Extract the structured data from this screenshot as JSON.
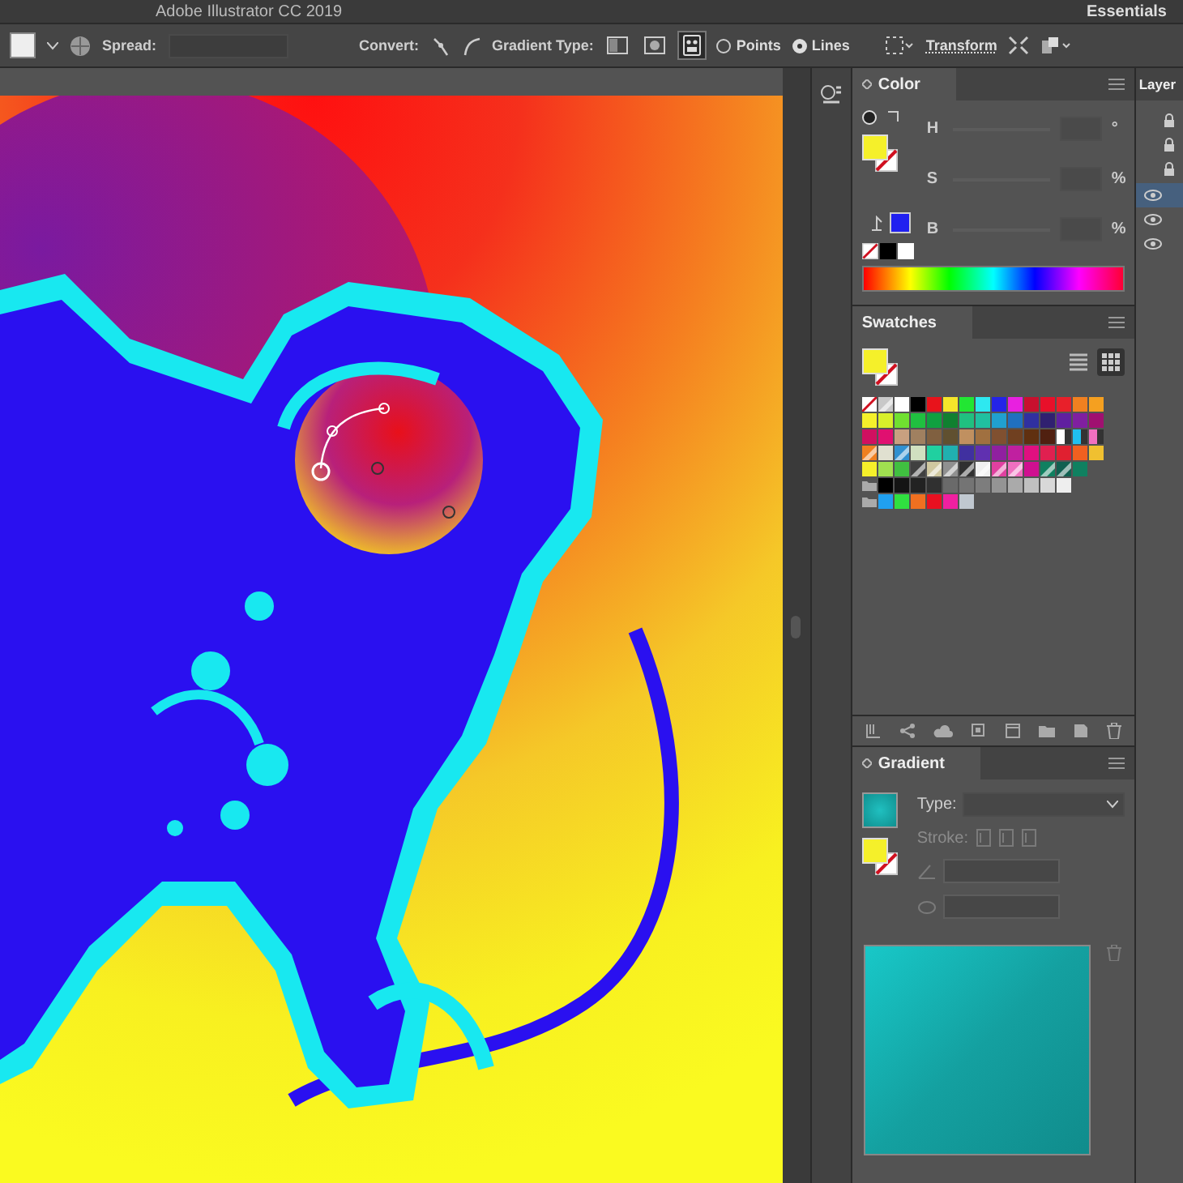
{
  "window": {
    "title": "Adobe Illustrator CC 2019",
    "workspace": "Essentials"
  },
  "control_bar": {
    "spread_label": "Spread:",
    "convert_label": "Convert:",
    "gradient_type_label": "Gradient Type:",
    "gradient_types": [
      {
        "kind": "linear",
        "selected": false
      },
      {
        "kind": "radial",
        "selected": false
      },
      {
        "kind": "freeform",
        "selected": true
      }
    ],
    "modes": [
      {
        "label": "Points",
        "selected": false
      },
      {
        "label": "Lines",
        "selected": true
      }
    ],
    "transform": "Transform"
  },
  "color_panel": {
    "title": "Color",
    "channels": [
      {
        "name": "H",
        "unit": "°"
      },
      {
        "name": "S",
        "unit": "%"
      },
      {
        "name": "B",
        "unit": "%"
      }
    ]
  },
  "swatches_panel": {
    "title": "Swatches",
    "views": [
      {
        "kind": "list",
        "selected": false
      },
      {
        "kind": "grid",
        "selected": true
      }
    ],
    "rows": [
      [
        {
          "kind": "none"
        },
        {
          "kind": "pattern",
          "color": "#c8c8c8"
        },
        {
          "kind": "color",
          "color": "#ffffff"
        },
        {
          "kind": "color",
          "color": "#000000"
        },
        {
          "kind": "color",
          "color": "#e8131b"
        },
        {
          "kind": "color",
          "color": "#f5e52a"
        },
        {
          "kind": "color",
          "color": "#22e633"
        },
        {
          "kind": "color",
          "color": "#2ee8f0"
        },
        {
          "kind": "color",
          "color": "#2424e8"
        },
        {
          "kind": "color",
          "color": "#e820e0"
        },
        {
          "kind": "color",
          "color": "#c8102e"
        },
        {
          "kind": "color",
          "color": "#e8102a"
        },
        {
          "kind": "color",
          "color": "#e8202a"
        },
        {
          "kind": "color",
          "color": "#f08020"
        },
        {
          "kind": "color",
          "color": "#f5a020"
        }
      ],
      [
        {
          "kind": "color",
          "color": "#f5f02a"
        },
        {
          "kind": "color",
          "color": "#d8f02a"
        },
        {
          "kind": "color",
          "color": "#70e030"
        },
        {
          "kind": "color",
          "color": "#20c040"
        },
        {
          "kind": "color",
          "color": "#10a040"
        },
        {
          "kind": "color",
          "color": "#108030"
        },
        {
          "kind": "color",
          "color": "#20c080"
        },
        {
          "kind": "color",
          "color": "#20c0a0"
        },
        {
          "kind": "color",
          "color": "#20a0d0"
        },
        {
          "kind": "color",
          "color": "#2070c0"
        },
        {
          "kind": "color",
          "color": "#3030a0"
        },
        {
          "kind": "color",
          "color": "#302070"
        },
        {
          "kind": "color",
          "color": "#6020a0"
        },
        {
          "kind": "color",
          "color": "#8020a0"
        },
        {
          "kind": "color",
          "color": "#a01070"
        }
      ],
      [
        {
          "kind": "color",
          "color": "#d01060"
        },
        {
          "kind": "color",
          "color": "#e01070"
        },
        {
          "kind": "color",
          "color": "#c8a080"
        },
        {
          "kind": "color",
          "color": "#a08060"
        },
        {
          "kind": "color",
          "color": "#806040"
        },
        {
          "kind": "color",
          "color": "#605030"
        },
        {
          "kind": "color",
          "color": "#c09060"
        },
        {
          "kind": "color",
          "color": "#a07040"
        },
        {
          "kind": "color",
          "color": "#805030"
        },
        {
          "kind": "color",
          "color": "#704020"
        },
        {
          "kind": "color",
          "color": "#603010"
        },
        {
          "kind": "color",
          "color": "#502010"
        },
        {
          "kind": "gradient",
          "color": "#ffffff"
        },
        {
          "kind": "gradient",
          "color": "#20c0f0"
        },
        {
          "kind": "gradient",
          "color": "#f070c0"
        }
      ],
      [
        {
          "kind": "pattern",
          "color": "#f08020"
        },
        {
          "kind": "color",
          "color": "#e0e0d0"
        },
        {
          "kind": "pattern",
          "color": "#3090d0"
        },
        {
          "kind": "color",
          "color": "#d0e0c0"
        },
        {
          "kind": "color",
          "color": "#20d0a0"
        },
        {
          "kind": "color",
          "color": "#20b0b0"
        },
        {
          "kind": "color",
          "color": "#4030a0"
        },
        {
          "kind": "color",
          "color": "#6030b0"
        },
        {
          "kind": "color",
          "color": "#9020a0"
        },
        {
          "kind": "color",
          "color": "#c020a0"
        },
        {
          "kind": "color",
          "color": "#e01080"
        },
        {
          "kind": "color",
          "color": "#e02050"
        },
        {
          "kind": "color",
          "color": "#e02030"
        },
        {
          "kind": "color",
          "color": "#f06020"
        },
        {
          "kind": "color",
          "color": "#f0c030"
        }
      ],
      [
        {
          "kind": "color",
          "color": "#f5f02a"
        },
        {
          "kind": "color",
          "color": "#a0e050"
        },
        {
          "kind": "color",
          "color": "#40c040"
        },
        {
          "kind": "pattern",
          "color": "#404040"
        },
        {
          "kind": "pattern",
          "color": "#d0c8a0"
        },
        {
          "kind": "pattern",
          "color": "#909090"
        },
        {
          "kind": "pattern",
          "color": "#303030"
        },
        {
          "kind": "pattern",
          "color": "#f0f0f0"
        },
        {
          "kind": "pattern",
          "color": "#e040a0"
        },
        {
          "kind": "pattern",
          "color": "#f070c0"
        },
        {
          "kind": "color",
          "color": "#d01090"
        },
        {
          "kind": "pattern",
          "color": "#108060"
        },
        {
          "kind": "pattern",
          "color": "#106050"
        },
        {
          "kind": "color",
          "color": "#108060"
        }
      ],
      [
        {
          "kind": "folder"
        },
        {
          "kind": "color",
          "color": "#000000"
        },
        {
          "kind": "color",
          "color": "#141414"
        },
        {
          "kind": "color",
          "color": "#222222"
        },
        {
          "kind": "color",
          "color": "#303030"
        },
        {
          "kind": "color",
          "color": "#6a6a6a"
        },
        {
          "kind": "color",
          "color": "#747474"
        },
        {
          "kind": "color",
          "color": "#7d7d7d"
        },
        {
          "kind": "color",
          "color": "#949494"
        },
        {
          "kind": "color",
          "color": "#aaaaaa"
        },
        {
          "kind": "color",
          "color": "#c0c0c0"
        },
        {
          "kind": "color",
          "color": "#d8d8d8"
        },
        {
          "kind": "color",
          "color": "#eeeeee"
        }
      ],
      [
        {
          "kind": "folder"
        },
        {
          "kind": "color",
          "color": "#20a0f0"
        },
        {
          "kind": "color",
          "color": "#30e040"
        },
        {
          "kind": "color",
          "color": "#f07020"
        },
        {
          "kind": "color",
          "color": "#e81020"
        },
        {
          "kind": "color",
          "color": "#f020a0"
        },
        {
          "kind": "color",
          "color": "#c0c8d0"
        }
      ]
    ]
  },
  "gradient_panel": {
    "title": "Gradient",
    "type_label": "Type:",
    "stroke": {
      "label": "Stroke:",
      "disabled": true
    }
  },
  "layers_panel": {
    "title": "Layer",
    "rows": [
      {
        "locked": true,
        "visible": false,
        "selected": false
      },
      {
        "locked": true,
        "visible": false,
        "selected": false
      },
      {
        "locked": true,
        "visible": false,
        "selected": false
      },
      {
        "locked": false,
        "visible": true,
        "selected": true
      },
      {
        "locked": false,
        "visible": true,
        "selected": false
      },
      {
        "locked": false,
        "visible": true,
        "selected": false
      }
    ]
  }
}
